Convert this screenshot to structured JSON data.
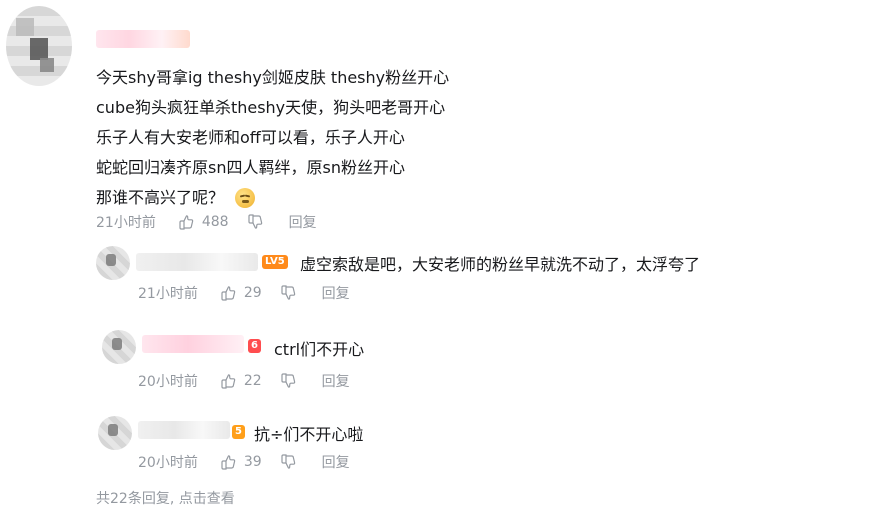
{
  "main_comment": {
    "content_lines": [
      "今天shy哥拿ig theshy剑姬皮肤  theshy粉丝开心",
      "cube狗头疯狂单杀theshy天使，狗头吧老哥开心",
      "乐子人有大安老师和off可以看，乐子人开心",
      "蛇蛇回归凑齐原sn四人羁绊，原sn粉丝开心",
      "那谁不高兴了呢？"
    ],
    "emoji": "thinking-face",
    "time": "21小时前",
    "likes": "488",
    "reply_label": "回复"
  },
  "replies": [
    {
      "level_badge": "LV5",
      "text": "虚空索敌是吧，大安老师的粉丝早就洗不动了，太浮夸了",
      "time": "21小时前",
      "likes": "29",
      "reply_label": "回复"
    },
    {
      "level_badge": "6",
      "text": "ctrl们不开心",
      "time": "20小时前",
      "likes": "22",
      "reply_label": "回复"
    },
    {
      "level_badge": "5",
      "text": "抗÷们不开心啦",
      "time": "20小时前",
      "likes": "39",
      "reply_label": "回复"
    }
  ],
  "footer": {
    "text": "共22条回复, 点击查看"
  },
  "colors": {
    "text_primary": "#18191c",
    "text_meta": "#9499a0",
    "level_badge": "#ff8a1a"
  },
  "icons": {
    "like": "thumbs-up-icon",
    "dislike": "thumbs-down-icon"
  }
}
